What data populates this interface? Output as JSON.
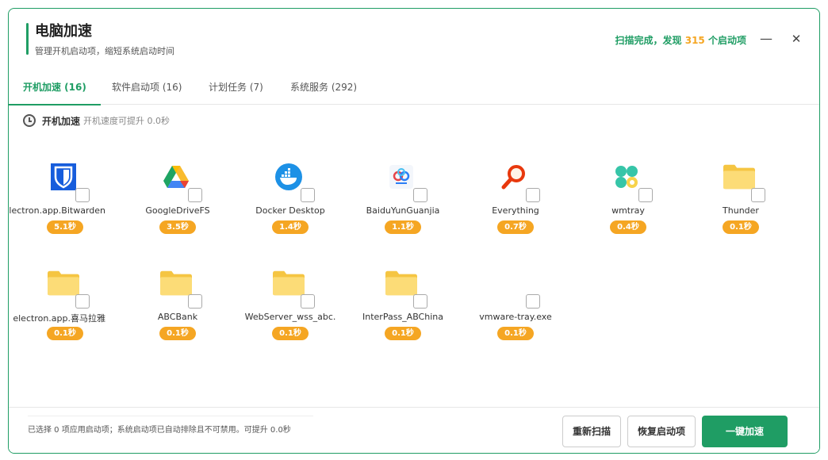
{
  "header": {
    "title": "电脑加速",
    "subtitle": "管理开机启动项，缩短系统启动时间",
    "scan_prefix": "扫描完成，发现",
    "scan_count": "315",
    "scan_suffix": "个启动项",
    "minimize_icon": "—",
    "close_icon": "✕"
  },
  "tabs": [
    {
      "label": "开机加速 (16)",
      "active": true
    },
    {
      "label": "软件启动项 (16)",
      "active": false
    },
    {
      "label": "计划任务 (7)",
      "active": false
    },
    {
      "label": "系统服务 (292)",
      "active": false
    }
  ],
  "section": {
    "title": "开机加速",
    "desc": "开机速度可提升 0.0秒"
  },
  "items": [
    {
      "name": "electron.app.Bitwarden",
      "time": "5.1秒",
      "icon": "bitwarden-icon"
    },
    {
      "name": "GoogleDriveFS",
      "time": "3.5秒",
      "icon": "google-drive-icon"
    },
    {
      "name": "Docker Desktop",
      "time": "1.4秒",
      "icon": "docker-icon"
    },
    {
      "name": "BaiduYunGuanjia",
      "time": "1.1秒",
      "icon": "baidu-netdisk-icon"
    },
    {
      "name": "Everything",
      "time": "0.7秒",
      "icon": "everything-search-icon"
    },
    {
      "name": "wmtray",
      "time": "0.4秒",
      "icon": "wmtray-icon"
    },
    {
      "name": "Thunder",
      "time": "0.1秒",
      "icon": "folder-icon"
    },
    {
      "name": "electron.app.喜马拉雅",
      "time": "0.1秒",
      "icon": "folder-icon"
    },
    {
      "name": "ABCBank",
      "time": "0.1秒",
      "icon": "folder-icon"
    },
    {
      "name": "WebServer_wss_abc.",
      "time": "0.1秒",
      "icon": "folder-icon"
    },
    {
      "name": "InterPass_ABChina",
      "time": "0.1秒",
      "icon": "folder-icon"
    },
    {
      "name": "vmware-tray.exe",
      "time": "0.1秒",
      "icon": "none"
    }
  ],
  "footer": {
    "note": "已选择 0 项应用启动项；系统启动项已自动排除且不可禁用。可提升 0.0秒",
    "rescan": "重新扫描",
    "restore": "恢复启动项",
    "boost": "一键加速"
  },
  "colors": {
    "accent": "#1f9d64",
    "badge": "#f5a623"
  }
}
